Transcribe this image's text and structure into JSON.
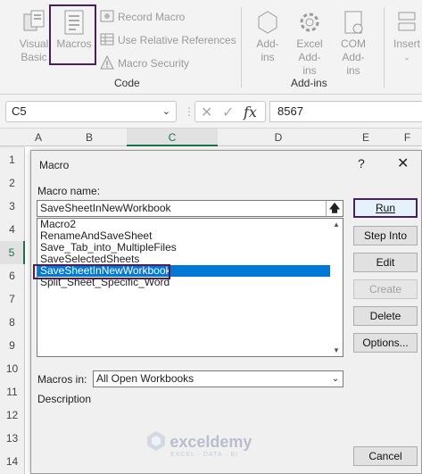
{
  "ribbon": {
    "code_group": {
      "visual_basic_label": "Visual Basic",
      "macros_label": "Macros",
      "record_macro_label": "Record Macro",
      "relative_refs_label": "Use Relative References",
      "macro_security_label": "Macro Security",
      "group_label": "Code"
    },
    "addins_group": {
      "addins_label": "Add-ins",
      "excel_addins_label": "Excel Add-ins",
      "com_addins_label": "COM Add-ins",
      "group_label": "Add-ins"
    },
    "insert_label": "Insert"
  },
  "formula_bar": {
    "name_box": "C5",
    "fx": "fx",
    "value": "8567"
  },
  "grid": {
    "columns": [
      "A",
      "B",
      "C",
      "D",
      "E",
      "F"
    ],
    "rows": [
      "1",
      "2",
      "3",
      "4",
      "5",
      "6",
      "7",
      "8",
      "9",
      "10",
      "11",
      "12",
      "13",
      "14"
    ],
    "selected_column": "C",
    "selected_row": "5"
  },
  "dialog": {
    "title": "Macro",
    "help": "?",
    "close": "✕",
    "macro_name_label": "Macro name:",
    "macro_name_value": "SaveSheetInNewWorkbook",
    "macros": [
      "Macro2",
      "RenameAndSaveSheet",
      "Save_Tab_into_MultipleFiles",
      "SaveSelectedSheets",
      "SaveSheetInNewWorkbook",
      "Split_Sheet_Specific_Word"
    ],
    "selected_index": 4,
    "buttons": {
      "run": "Run",
      "step_into": "Step Into",
      "edit": "Edit",
      "create": "Create",
      "delete": "Delete",
      "options": "Options...",
      "cancel": "Cancel"
    },
    "macros_in_label": "Macros in:",
    "macros_in_value": "All Open Workbooks",
    "description_label": "Description"
  },
  "watermark": {
    "name": "exceldemy",
    "tagline": "EXCEL · DATA · BI"
  }
}
